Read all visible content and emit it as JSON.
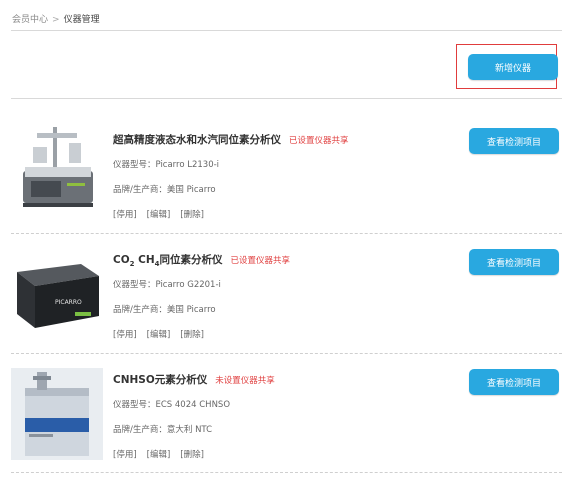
{
  "breadcrumb": {
    "home": "会员中心",
    "separator": ">",
    "current": "仪器管理"
  },
  "add_button": "新增仪器",
  "colors": {
    "accent": "#29a8e0",
    "share_text": "#e04040",
    "highlight_border": "#e03c3c"
  },
  "instruments": [
    {
      "name": "超高精度液态水和水汽同位素分析仪",
      "share_status": "已设置仪器共享",
      "model": "仪器型号：Picarro L2130-i",
      "brand": "品牌/生产商：美国 Picarro",
      "actions": [
        "[停用]",
        "[编辑]",
        "[删除]"
      ],
      "view_button": "查看检测项目",
      "image_icon": "analyzer-autosampler-image"
    },
    {
      "name_parts": [
        "CO",
        "2",
        " CH",
        "4",
        "同位素分析仪"
      ],
      "share_status": "已设置仪器共享",
      "model": "仪器型号：Picarro G2201-i",
      "brand": "品牌/生产商：美国 Picarro",
      "actions": [
        "[停用]",
        "[编辑]",
        "[删除]"
      ],
      "view_button": "查看检测项目",
      "image_icon": "picarro-analyzer-image",
      "image_logo": "PICARRO"
    },
    {
      "name": "CNHSO元素分析仪",
      "share_status": "未设置仪器共享",
      "model": "仪器型号：ECS 4024 CHNSO",
      "brand": "品牌/生产商：意大利 NTC",
      "actions": [
        "[停用]",
        "[编辑]",
        "[删除]"
      ],
      "view_button": "查看检测项目",
      "image_icon": "elemental-analyzer-image"
    }
  ]
}
